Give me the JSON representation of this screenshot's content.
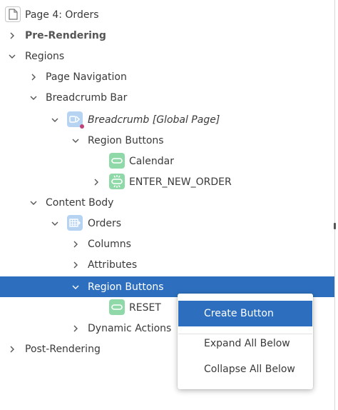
{
  "tree": {
    "page_title": "Page 4: Orders",
    "pre_rendering": "Pre-Rendering",
    "regions": "Regions",
    "page_navigation": "Page Navigation",
    "breadcrumb_bar": "Breadcrumb Bar",
    "breadcrumb_region": "Breadcrumb [Global Page]",
    "region_buttons_1": "Region Buttons",
    "calendar_button": "Calendar",
    "enter_new_order_button": "ENTER_NEW_ORDER",
    "content_body": "Content Body",
    "orders_region": "Orders",
    "columns": "Columns",
    "attributes": "Attributes",
    "region_buttons_2": "Region Buttons",
    "reset_button": "RESET",
    "dynamic_actions": "Dynamic Actions",
    "post_rendering": "Post-Rendering"
  },
  "context_menu": {
    "items": [
      "Create Button",
      "Expand All Below",
      "Collapse All Below"
    ]
  },
  "colors": {
    "selection": "#2d6fbe",
    "region_icon": "#b7d3f2",
    "button_icon": "#8fd9a8",
    "global_dot": "#c0427a"
  }
}
